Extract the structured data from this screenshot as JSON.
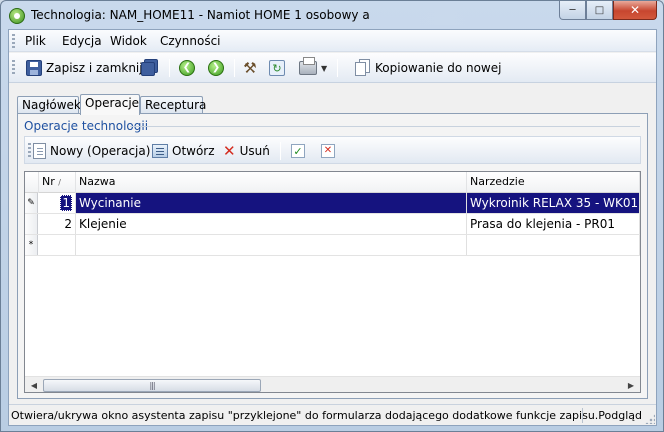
{
  "window": {
    "title": "Technologia: NAM_HOME11 - Namiot HOME 1 osobowy a",
    "buttons": {
      "minimize": "─",
      "maximize": "□",
      "close": "✕"
    }
  },
  "menu": [
    "Plik",
    "Edycja",
    "Widok",
    "Czynności"
  ],
  "toolbar": {
    "save_close": "Zapisz i zamknij",
    "copy_new": "Kopiowanie do nowej"
  },
  "tabs": [
    "Nagłówek",
    "Operacje",
    "Receptura"
  ],
  "active_tab": "Operacje",
  "group": {
    "title": "Operacje technologii"
  },
  "inner_toolbar": {
    "new": "Nowy (Operacja)",
    "open": "Otwórz",
    "delete": "Usuń"
  },
  "grid": {
    "columns": [
      "Nr",
      "Nazwa",
      "Narzedzie"
    ],
    "sort_marker": "/",
    "rows": [
      {
        "indicator": "✎",
        "nr": "1",
        "nazwa": "Wycinanie",
        "narzedzie": "Wykroinik RELAX 35 - WK01..."
      },
      {
        "indicator": "",
        "nr": "2",
        "nazwa": "Klejenie",
        "narzedzie": "Prasa do klejenia - PR01"
      }
    ],
    "new_row_indicator": "*"
  },
  "status": {
    "message": "Otwiera/ukrywa okno asystenta zapisu \"przyklejone\" do formularza dodającego dodatkowe funkcje zapisu.",
    "mode": "Podgląd"
  },
  "colors": {
    "selection": "#15137f",
    "group_title": "#1e50a0"
  }
}
